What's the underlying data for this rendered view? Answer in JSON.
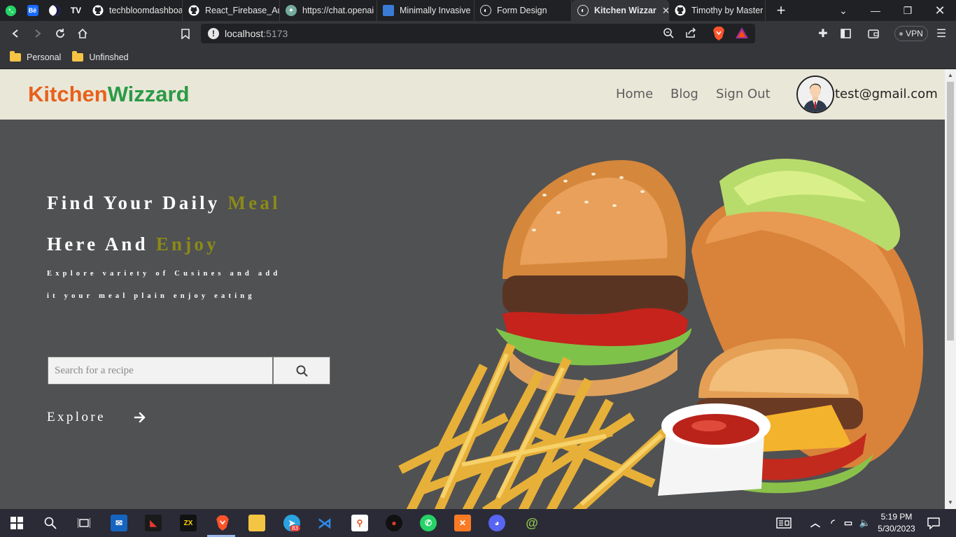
{
  "browser": {
    "tabs": [
      {
        "label": "techbloomdashboa",
        "icon": "github-icon"
      },
      {
        "label": "React_Firebase_Aut",
        "icon": "github-icon"
      },
      {
        "label": "https://chat.openai",
        "icon": "openai-icon"
      },
      {
        "label": "Minimally Invasive",
        "icon": "page-icon"
      },
      {
        "label": "Form Design",
        "icon": "globe-icon"
      },
      {
        "label": "Kitchen Wizzar",
        "icon": "globe-icon",
        "active": true
      },
      {
        "label": "Timothy by Master",
        "icon": "github-icon"
      }
    ],
    "url_host": "localhost",
    "url_port": ":5173",
    "vpn_label": "VPN",
    "bookmarks": [
      "Personal",
      "Unfinshed"
    ]
  },
  "navbar": {
    "logo_part1": "Kitchen",
    "logo_part2": "Wizzard",
    "links": [
      "Home",
      "Blog",
      "Sign Out"
    ],
    "email": "test@gmail.com",
    "colors": {
      "logo_orange": "#e8601c",
      "logo_green": "#2a9a46",
      "navbar_bg": "#e9e7d8"
    }
  },
  "hero": {
    "line1_white": "Find Your Daily",
    "line1_highlight": "Meal",
    "line2_white": "Here And",
    "line2_highlight": "Enjoy",
    "desc1": "Explore variety of Cusines and add",
    "desc2": "it your meal plain enjoy eating",
    "search_placeholder": "Search for a recipe",
    "explore_label": "Explore",
    "colors": {
      "bg": "#505152",
      "highlight": "#8b8a18"
    }
  },
  "taskbar": {
    "time": "5:19 PM",
    "date": "5/30/2023",
    "telegram_badge": "83"
  }
}
